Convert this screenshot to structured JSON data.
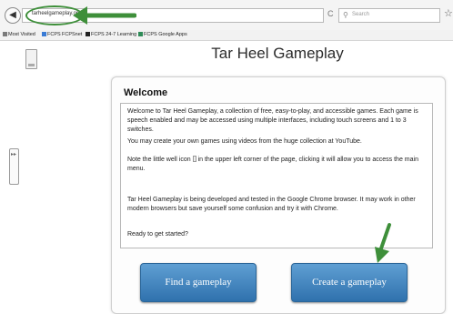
{
  "browser": {
    "url": "tarheelgameplay.org",
    "reload_glyph": "C",
    "search_placeholder": "Search",
    "back_glyph": "◀",
    "star_glyph": "☆",
    "bookmarks": [
      {
        "label": "Most Visited",
        "icon_color": "#7a7a7a"
      },
      {
        "label": "FCPS",
        "icon_color": "#3a7bd5"
      },
      {
        "label": "FCPSnet",
        "icon_color": "#555555"
      },
      {
        "label": "FCPS 24-7 Learning",
        "icon_color": "#222222"
      },
      {
        "label": "FCPS Google Apps",
        "icon_color": "#2e8b57"
      }
    ]
  },
  "site": {
    "title": "Tar Heel Gameplay",
    "side_handle_glyph": "▸▸"
  },
  "welcome": {
    "heading": "Welcome",
    "p1": "Welcome to Tar Heel Gameplay, a collection of free, easy-to-play, and accessible games. Each game is speech enabled and may be accessed using multiple interfaces, including touch screens and 1 to 3 switches.",
    "p2": "You may create your own games using videos from the huge collection at YouTube.",
    "p3_before": "Note the little well icon",
    "p3_after": "in the upper left corner of the page, clicking it will allow you to access the main menu.",
    "p4": "Tar Heel Gameplay is being developed and tested in the Google Chrome browser. It may work in other modern browsers but save yourself some confusion and try it with Chrome.",
    "p5": "Ready to get started?"
  },
  "buttons": {
    "find": "Find a gameplay",
    "create": "Create a gameplay"
  },
  "colors": {
    "annotation_green": "#3e8f3a",
    "button_blue": "#3f80bd"
  }
}
